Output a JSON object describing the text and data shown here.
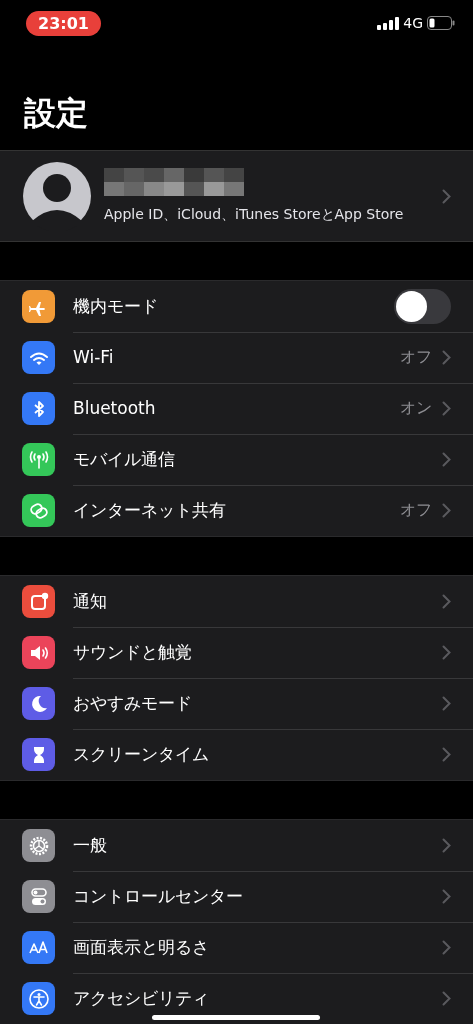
{
  "status_bar": {
    "time": "23:01",
    "network": "4G"
  },
  "title": "設定",
  "profile": {
    "subtitle": "Apple ID、iCloud、iTunes StoreとApp Store"
  },
  "sections": [
    {
      "items": [
        {
          "kind": "toggle",
          "label": "機内モード",
          "on": false,
          "color": "#f19a37"
        },
        {
          "kind": "link",
          "label": "Wi-Fi",
          "value": "オフ",
          "color": "#3478f6"
        },
        {
          "kind": "link",
          "label": "Bluetooth",
          "value": "オン",
          "color": "#3478f6"
        },
        {
          "kind": "link",
          "label": "モバイル通信",
          "color": "#34c759"
        },
        {
          "kind": "link",
          "label": "インターネット共有",
          "value": "オフ",
          "color": "#34c759"
        }
      ]
    },
    {
      "items": [
        {
          "kind": "link",
          "label": "通知",
          "color": "#eb4d3d"
        },
        {
          "kind": "link",
          "label": "サウンドと触覚",
          "color": "#eb445a"
        },
        {
          "kind": "link",
          "label": "おやすみモード",
          "color": "#5e5ce6"
        },
        {
          "kind": "link",
          "label": "スクリーンタイム",
          "color": "#5e5ce6"
        }
      ]
    },
    {
      "items": [
        {
          "kind": "link",
          "label": "一般",
          "color": "#8e8e93"
        },
        {
          "kind": "link",
          "label": "コントロールセンター",
          "color": "#8e8e93"
        },
        {
          "kind": "link",
          "label": "画面表示と明るさ",
          "color": "#3478f6"
        },
        {
          "kind": "link",
          "label": "アクセシビリティ",
          "color": "#3478f6"
        }
      ]
    }
  ]
}
